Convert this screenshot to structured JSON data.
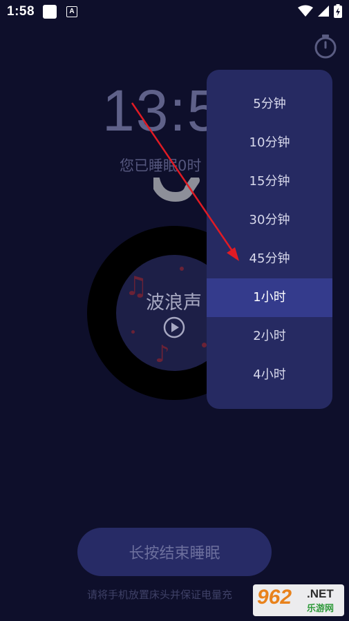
{
  "status_bar": {
    "time": "1:58",
    "a_label": "A"
  },
  "main": {
    "clock_text": "13:5",
    "slept_text": "您已睡眠0时",
    "sound_title": "波浪声",
    "end_button_label": "长按结束睡眠",
    "hint_text": "请将手机放置床头并保证电量充"
  },
  "dropdown": {
    "items": [
      {
        "label": "5分钟",
        "selected": false
      },
      {
        "label": "10分钟",
        "selected": false
      },
      {
        "label": "15分钟",
        "selected": false
      },
      {
        "label": "30分钟",
        "selected": false
      },
      {
        "label": "45分钟",
        "selected": false
      },
      {
        "label": "1小时",
        "selected": true
      },
      {
        "label": "2小时",
        "selected": false
      },
      {
        "label": "4小时",
        "selected": false
      }
    ]
  },
  "watermark": {
    "number": "962",
    "suffix": ".NET",
    "cn": "乐游网"
  },
  "colors": {
    "background": "#0e0f2b",
    "dropdown_bg": "#262a62",
    "selected_bg": "#343b8c",
    "annotation_arrow": "#e01b24"
  }
}
